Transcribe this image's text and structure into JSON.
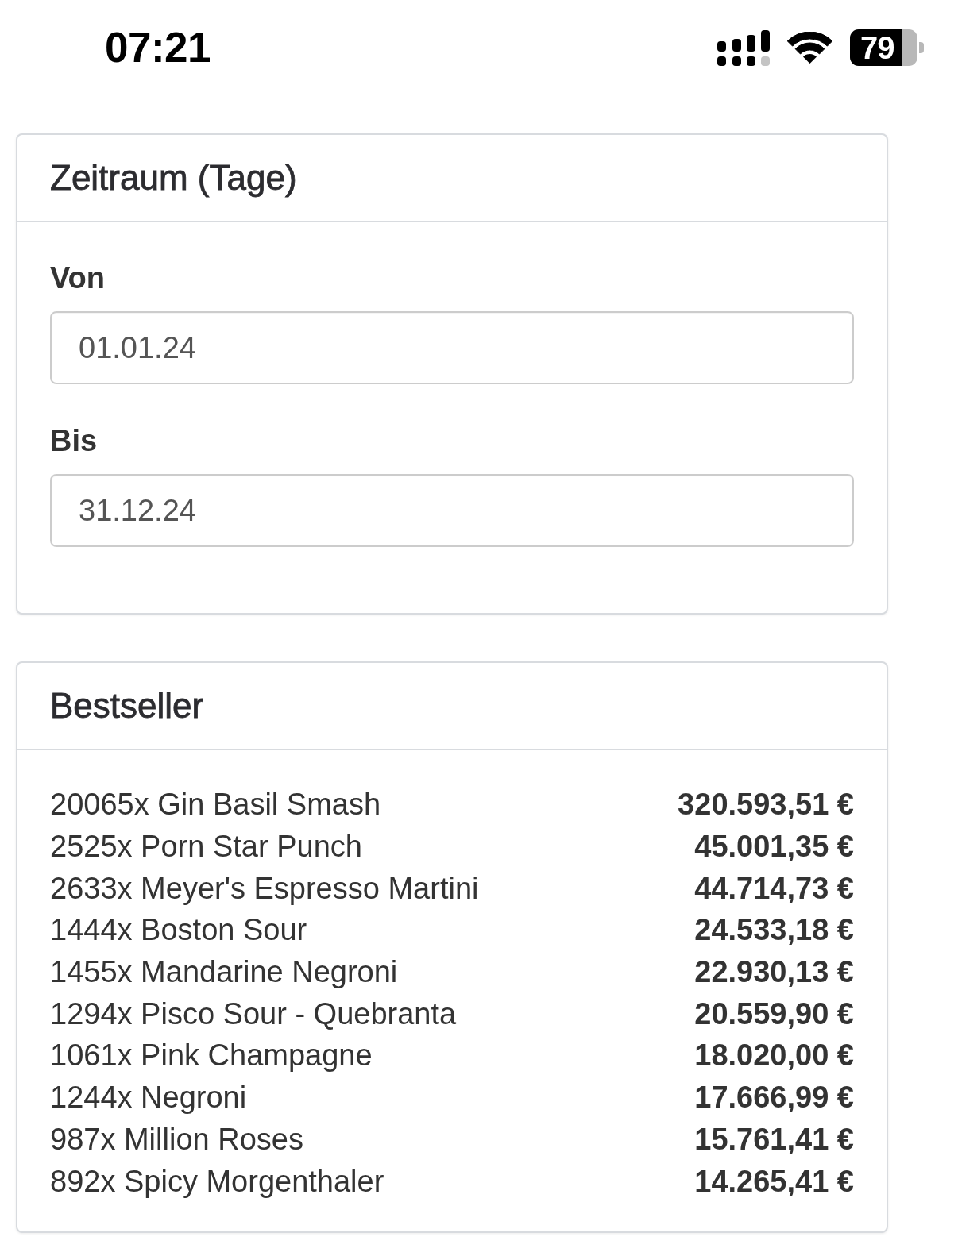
{
  "status_bar": {
    "time": "07:21",
    "battery": "79"
  },
  "date_range": {
    "title": "Zeitraum (Tage)",
    "fields": [
      {
        "label": "Von",
        "value": "01.01.24"
      },
      {
        "label": "Bis",
        "value": "31.12.24"
      }
    ]
  },
  "bestseller": {
    "title": "Bestseller",
    "rows": [
      {
        "item": "20065x Gin Basil Smash",
        "revenue": "320.593,51 €"
      },
      {
        "item": "2525x Porn Star Punch",
        "revenue": "45.001,35 €"
      },
      {
        "item": "2633x Meyer's Espresso Martini",
        "revenue": "44.714,73 €"
      },
      {
        "item": "1444x Boston Sour",
        "revenue": "24.533,18 €"
      },
      {
        "item": "1455x Mandarine Negroni",
        "revenue": "22.930,13 €"
      },
      {
        "item": "1294x Pisco Sour - Quebranta",
        "revenue": "20.559,90 €"
      },
      {
        "item": "1061x Pink Champagne",
        "revenue": "18.020,00 €"
      },
      {
        "item": "1244x Negroni",
        "revenue": "17.666,99 €"
      },
      {
        "item": "987x Million Roses",
        "revenue": "15.761,41 €"
      },
      {
        "item": "892x Spicy Morgenthaler",
        "revenue": "14.265,41 €"
      }
    ]
  }
}
